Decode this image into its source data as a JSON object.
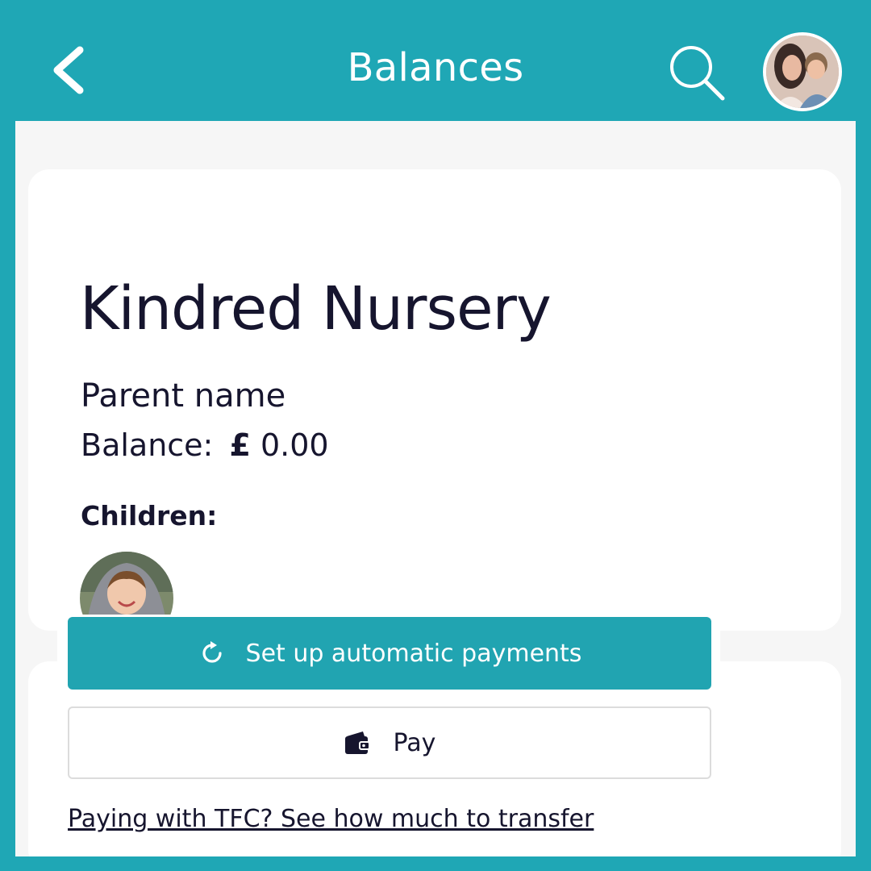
{
  "header": {
    "title": "Balances",
    "back_icon": "chevron-left-icon",
    "search_icon": "search-icon",
    "avatar": "user-avatar"
  },
  "card": {
    "nursery_name": "Kindred Nursery",
    "parent_label": "Parent name",
    "balance_label": "Balance:",
    "balance_currency": "£",
    "balance_value": "0.00",
    "children_label": "Children:",
    "child_avatar": "child-avatar"
  },
  "actions": {
    "auto_payments_label": "Set up automatic payments",
    "auto_payments_icon": "refresh-icon",
    "pay_label": "Pay",
    "pay_icon": "wallet-icon",
    "tfc_link": "Paying with TFC? See how much to transfer"
  },
  "colors": {
    "brand": "#1fa7b5",
    "button": "#21a4b1",
    "text": "#16152e"
  }
}
